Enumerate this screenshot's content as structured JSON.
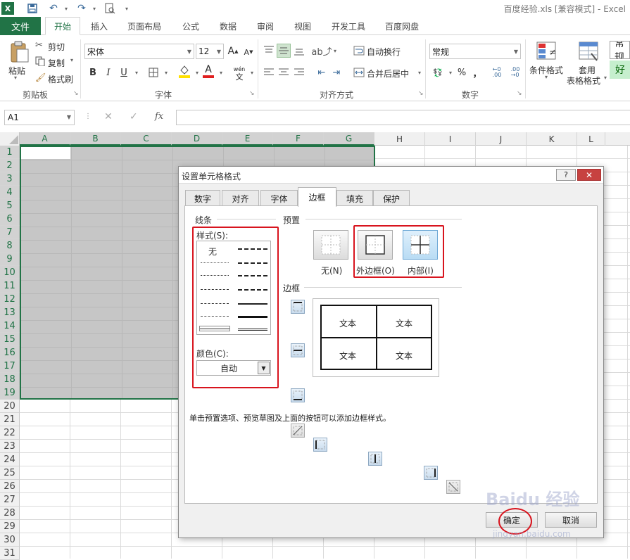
{
  "window": {
    "title": "百度经验.xls  [兼容模式] - Excel"
  },
  "ribbon_tabs": {
    "file": "文件",
    "items": [
      "开始",
      "插入",
      "页面布局",
      "公式",
      "数据",
      "审阅",
      "视图",
      "开发工具",
      "百度网盘"
    ],
    "active": "开始"
  },
  "clipboard": {
    "paste": "粘贴",
    "cut": "剪切",
    "copy": "复制",
    "format_painter": "格式刷",
    "group": "剪贴板"
  },
  "font": {
    "name": "宋体",
    "size": "12",
    "bold": "B",
    "italic": "I",
    "underline": "U",
    "group": "字体",
    "wen": "wén",
    "wen_char": "文"
  },
  "alignment": {
    "wrap": "自动换行",
    "merge": "合并后居中",
    "group": "对齐方式"
  },
  "number": {
    "format": "常规",
    "percent": "%",
    "comma": "，",
    "group": "数字"
  },
  "styles": {
    "conditional": "条件格式",
    "table_line1": "套用",
    "table_line2": "表格格式",
    "normal": "常规",
    "good": "好"
  },
  "formula_bar": {
    "cell_ref": "A1",
    "fx": "fx",
    "cancel": "✕",
    "enter": "✓",
    "value": ""
  },
  "columns": [
    "A",
    "B",
    "C",
    "D",
    "E",
    "F",
    "G",
    "H",
    "I",
    "J",
    "K",
    "L"
  ],
  "rows": [
    "1",
    "2",
    "3",
    "4",
    "5",
    "6",
    "7",
    "8",
    "9",
    "10",
    "11",
    "12",
    "13",
    "14",
    "15",
    "16",
    "17",
    "18",
    "19",
    "20",
    "21",
    "22",
    "23",
    "24",
    "25",
    "26",
    "27",
    "28",
    "29",
    "30",
    "31"
  ],
  "dialog": {
    "title": "设置单元格格式",
    "help": "?",
    "close": "✕",
    "tabs": [
      "数字",
      "对齐",
      "字体",
      "边框",
      "填充",
      "保护"
    ],
    "active_tab": "边框",
    "line_group": "线条",
    "style_label": "样式(S):",
    "style_none": "无",
    "color_label": "颜色(C):",
    "color_value": "自动",
    "preset_group": "预置",
    "presets": [
      "无(N)",
      "外边框(O)",
      "内部(I)"
    ],
    "border_group": "边框",
    "preview_text": [
      "文本",
      "文本",
      "文本",
      "文本"
    ],
    "hint": "单击预置选项、预览草图及上面的按钮可以添加边框样式。",
    "ok": "确定",
    "cancel": "取消"
  },
  "watermark": {
    "main": "Baidu 经验",
    "url": "jingyan.baidu.com"
  }
}
